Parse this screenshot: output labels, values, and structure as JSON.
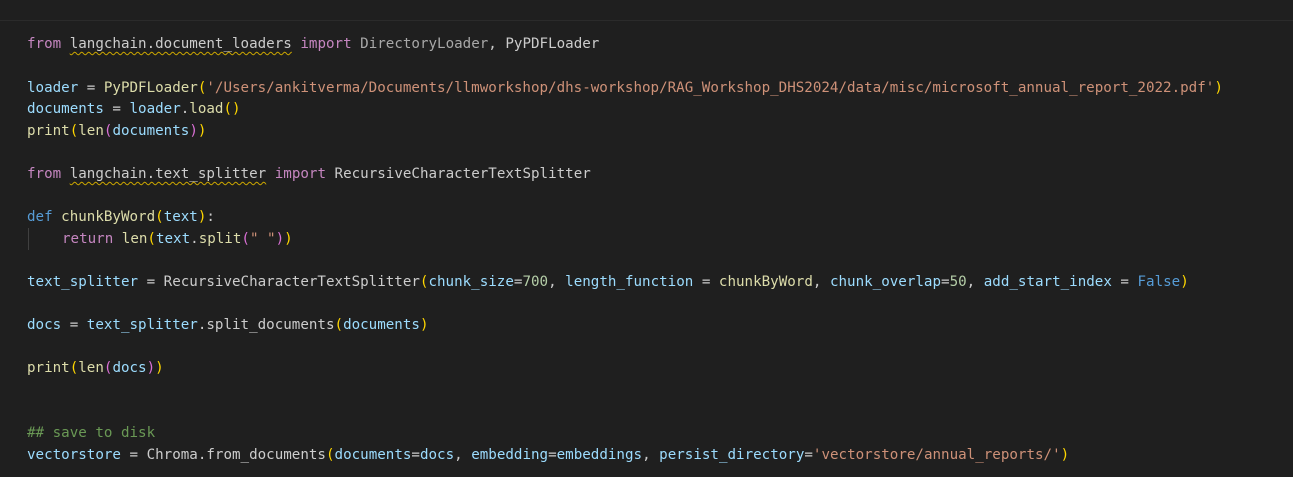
{
  "editor": {
    "line1": {
      "kw_from": "from",
      "module": "langchain.document_loaders",
      "kw_import": "import",
      "name1": "DirectoryLoader",
      "sep": ", ",
      "name2": "PyPDFLoader"
    },
    "line2": {
      "var": "loader",
      "op": " = ",
      "cls": "PyPDFLoader",
      "paren_open": "(",
      "str": "'/Users/ankitverma/Documents/llmworkshop/dhs-workshop/RAG_Workshop_DHS2024/data/misc/microsoft_annual_report_2022.pdf'",
      "paren_close": ")"
    },
    "line3": {
      "var": "documents",
      "op": " = ",
      "obj": "loader",
      "dot": ".",
      "method": "load",
      "parens": "()"
    },
    "line4": {
      "fn": "print",
      "p1": "(",
      "fn2": "len",
      "p2": "(",
      "arg": "documents",
      "p2c": ")",
      "p1c": ")"
    },
    "line5": {
      "kw_from": "from",
      "module": "langchain.text_splitter",
      "kw_import": "import",
      "name": "RecursiveCharacterTextSplitter"
    },
    "line6": {
      "kw_def": "def",
      "fn": "chunkByWord",
      "p_open": "(",
      "param": "text",
      "p_close": ")",
      "colon": ":"
    },
    "line7": {
      "kw_return": "return",
      "fn": "len",
      "p1": "(",
      "obj": "text",
      "dot": ".",
      "method": "split",
      "p2": "(",
      "str": "\" \"",
      "p2c": ")",
      "p1c": ")"
    },
    "line8": {
      "var": "text_splitter",
      "op": " = ",
      "cls": "RecursiveCharacterTextSplitter",
      "p_open": "(",
      "a1": "chunk_size",
      "eq1": "=",
      "n1": "700",
      "c1": ", ",
      "a2": "length_function",
      "eq2": " = ",
      "v2": "chunkByWord",
      "c2": ", ",
      "a3": "chunk_overlap",
      "eq3": "=",
      "n3": "50",
      "c3": ", ",
      "a4": "add_start_index",
      "eq4": " = ",
      "v4": "False",
      "p_close": ")"
    },
    "line9": {
      "var": "docs",
      "op": " = ",
      "obj": "text_splitter",
      "dot": ".",
      "method": "split_documents",
      "p_open": "(",
      "arg": "documents",
      "p_close": ")"
    },
    "line10": {
      "fn": "print",
      "p1": "(",
      "fn2": "len",
      "p2": "(",
      "arg": "docs",
      "p2c": ")",
      "p1c": ")"
    },
    "line11": {
      "comment": "## save to disk"
    },
    "line12": {
      "var": "vectorstore",
      "op": " = ",
      "cls": "Chroma",
      "dot": ".",
      "method": "from_documents",
      "p_open": "(",
      "a1": "documents",
      "eq1": "=",
      "v1": "docs",
      "c1": ", ",
      "a2": "embedding",
      "eq2": "=",
      "v2": "embeddings",
      "c2": ", ",
      "a3": "persist_directory",
      "eq3": "=",
      "str": "'vectorstore/annual_reports/'",
      "p_close": ")"
    }
  },
  "colors": {
    "background": "#1f1f1f",
    "keyword_control": "#c586c0",
    "keyword": "#569cd6",
    "function": "#dcdcaa",
    "variable": "#9cdcfe",
    "class": "#4ec9b0",
    "string": "#ce9178",
    "number": "#b5cea8",
    "comment": "#6a9955",
    "squiggle_warning": "#cca700"
  }
}
